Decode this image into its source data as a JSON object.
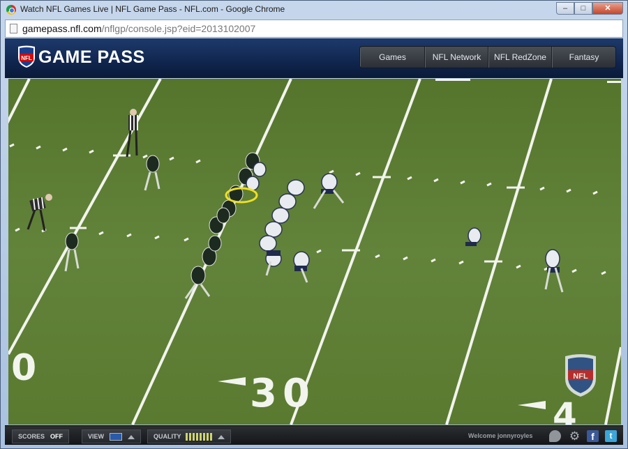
{
  "browser": {
    "window_title": "Watch NFL Games Live | NFL Game Pass - NFL.com - Google Chrome",
    "url_host": "gamepass.nfl.com",
    "url_path": "/nflgp/console.jsp?eid=2013102007",
    "controls": {
      "minimize": "–",
      "maximize": "□",
      "close": "✕"
    }
  },
  "header": {
    "logo_text": "GAME PASS",
    "shield_text": "NFL",
    "nav": [
      "Games",
      "NFL Network",
      "NFL RedZone",
      "Fantasy"
    ]
  },
  "field": {
    "yard_numbers": [
      "0",
      "30",
      "4"
    ],
    "watermark": "NFL",
    "colors": {
      "grass": "#5f7f33",
      "highlight": "#f0e020"
    }
  },
  "controlbar": {
    "scores_label": "SCORES",
    "scores_value": "OFF",
    "view_label": "VIEW",
    "quality_label": "QUALITY",
    "welcome": "Welcome jonnyroyles",
    "icons": [
      "chat-icon",
      "gear-icon",
      "facebook-icon",
      "twitter-icon"
    ],
    "fb_glyph": "f",
    "tw_glyph": "t"
  }
}
